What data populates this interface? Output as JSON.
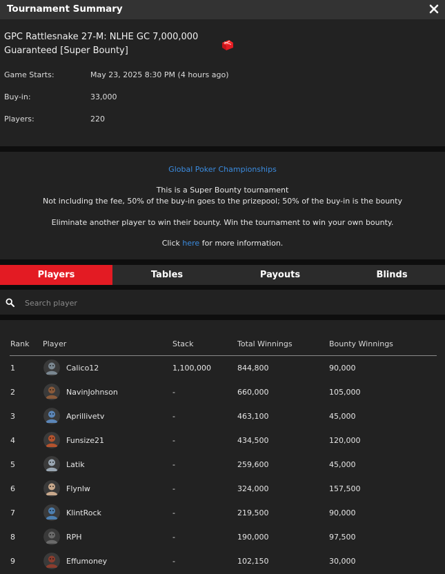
{
  "window": {
    "title": "Tournament Summary"
  },
  "tournament": {
    "name_line1": "GPC Rattlesnake 27-M: NLHE GC 7,000,000",
    "name_line2": "Guaranteed [Super Bounty]",
    "game_starts_label": "Game Starts:",
    "game_starts_value": "May 23, 2025 8:30 PM (4 hours ago)",
    "buyin_label": "Buy-in:",
    "buyin_value": "33,000",
    "players_label": "Players:",
    "players_value": "220"
  },
  "description": {
    "organizer": "Global Poker Championships",
    "line1": "This is a Super Bounty tournament",
    "line2": "Not including the fee, 50% of the buy-in goes to the prizepool; 50% of the buy-in is the bounty",
    "line3": "Eliminate another player to win their bounty. Win the tournament to win your own bounty.",
    "click_prefix": "Click ",
    "link_text": "here",
    "click_suffix": " for more information."
  },
  "tabs": [
    {
      "label": "Players",
      "active": true
    },
    {
      "label": "Tables",
      "active": false
    },
    {
      "label": "Payouts",
      "active": false
    },
    {
      "label": "Blinds",
      "active": false
    }
  ],
  "search": {
    "placeholder": "Search player"
  },
  "table": {
    "headers": {
      "rank": "Rank",
      "player": "Player",
      "stack": "Stack",
      "total": "Total Winnings",
      "bounty": "Bounty Winnings"
    },
    "rows": [
      {
        "rank": "1",
        "name": "Calico12",
        "stack": "1,100,000",
        "total": "844,800",
        "bounty": "90,000",
        "avatar_color": "#7a8791"
      },
      {
        "rank": "2",
        "name": "NavinJohnson",
        "stack": "-",
        "total": "660,000",
        "bounty": "105,000",
        "avatar_color": "#8a5a3a"
      },
      {
        "rank": "3",
        "name": "Aprillivetv",
        "stack": "-",
        "total": "463,100",
        "bounty": "45,000",
        "avatar_color": "#5b86b8"
      },
      {
        "rank": "4",
        "name": "Funsize21",
        "stack": "-",
        "total": "434,500",
        "bounty": "120,000",
        "avatar_color": "#b3532e"
      },
      {
        "rank": "5",
        "name": "Latik",
        "stack": "-",
        "total": "259,600",
        "bounty": "45,000",
        "avatar_color": "#9aa7b3"
      },
      {
        "rank": "6",
        "name": "Flynlw",
        "stack": "-",
        "total": "324,000",
        "bounty": "157,500",
        "avatar_color": "#c9a98c"
      },
      {
        "rank": "7",
        "name": "KlintRock",
        "stack": "-",
        "total": "219,500",
        "bounty": "90,000",
        "avatar_color": "#4d7fb0"
      },
      {
        "rank": "8",
        "name": "RPH",
        "stack": "-",
        "total": "190,000",
        "bounty": "97,500",
        "avatar_color": "#6a6a6a"
      },
      {
        "rank": "9",
        "name": "Effumoney",
        "stack": "-",
        "total": "102,150",
        "bounty": "30,000",
        "avatar_color": "#8b3d2e"
      }
    ]
  },
  "colors": {
    "accent": "#e31b23",
    "link": "#3b8ce0",
    "panel": "#222222",
    "background": "#0e0e0e"
  }
}
